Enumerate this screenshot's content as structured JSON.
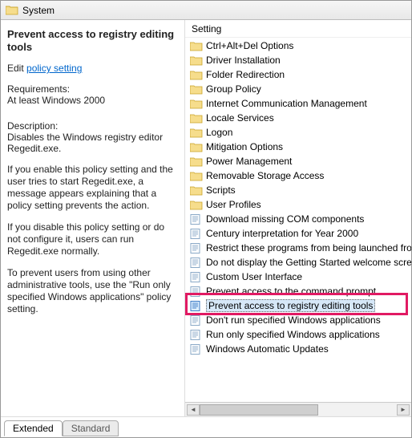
{
  "header": {
    "title": "System"
  },
  "leftPane": {
    "title": "Prevent access to registry editing tools",
    "editPrefix": "Edit ",
    "editLink": "policy setting ",
    "reqLabel": "Requirements:",
    "reqValue": "At least Windows 2000",
    "descLabel": "Description:",
    "descValue": "Disables the Windows registry editor Regedit.exe.",
    "p1": "If you enable this policy setting and the user tries to start Regedit.exe, a message appears explaining that a policy setting prevents the action.",
    "p2": "If you disable this policy setting or do not configure it, users can run Regedit.exe normally.",
    "p3": "To prevent users from using other administrative tools, use the \"Run only specified Windows applications\" policy setting."
  },
  "rightPane": {
    "columnHeader": "Setting",
    "items": [
      {
        "type": "folder",
        "label": "Ctrl+Alt+Del Options"
      },
      {
        "type": "folder",
        "label": "Driver Installation"
      },
      {
        "type": "folder",
        "label": "Folder Redirection"
      },
      {
        "type": "folder",
        "label": "Group Policy"
      },
      {
        "type": "folder",
        "label": "Internet Communication Management"
      },
      {
        "type": "folder",
        "label": "Locale Services"
      },
      {
        "type": "folder",
        "label": "Logon"
      },
      {
        "type": "folder",
        "label": "Mitigation Options"
      },
      {
        "type": "folder",
        "label": "Power Management"
      },
      {
        "type": "folder",
        "label": "Removable Storage Access"
      },
      {
        "type": "folder",
        "label": "Scripts"
      },
      {
        "type": "folder",
        "label": "User Profiles"
      },
      {
        "type": "setting",
        "label": "Download missing COM components"
      },
      {
        "type": "setting",
        "label": "Century interpretation for Year 2000"
      },
      {
        "type": "setting",
        "label": "Restrict these programs from being launched from Help"
      },
      {
        "type": "setting",
        "label": "Do not display the Getting Started welcome screen at log"
      },
      {
        "type": "setting",
        "label": "Custom User Interface"
      },
      {
        "type": "setting",
        "label": "Prevent access to the command prompt"
      },
      {
        "type": "setting",
        "label": "Prevent access to registry editing tools",
        "selected": true
      },
      {
        "type": "setting",
        "label": "Don't run specified Windows applications"
      },
      {
        "type": "setting",
        "label": "Run only specified Windows applications"
      },
      {
        "type": "setting",
        "label": "Windows Automatic Updates"
      }
    ]
  },
  "tabs": {
    "extended": "Extended",
    "standard": "Standard"
  },
  "icons": {
    "folder": "folder-icon",
    "setting": "setting-icon"
  },
  "highlightIndex": 18
}
